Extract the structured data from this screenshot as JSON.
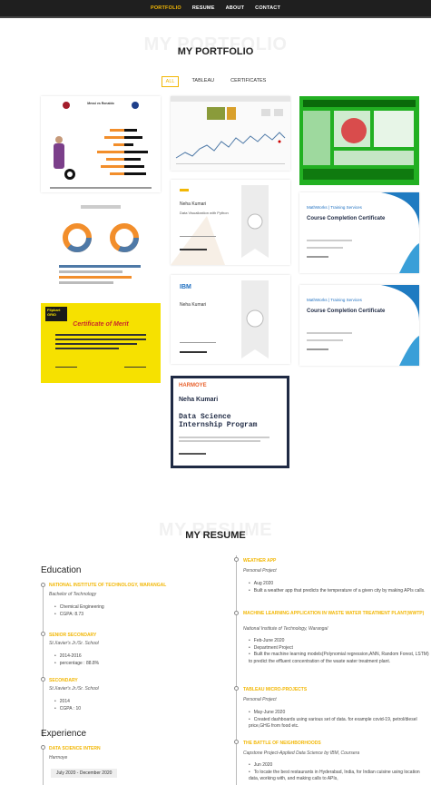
{
  "nav": {
    "items": [
      "PORTFOLIO",
      "RESUME",
      "ABOUT",
      "CONTACT"
    ]
  },
  "portfolio": {
    "ghost_title": "MY PORTFOLIO",
    "title": "MY PORTFOLIO",
    "filters": [
      "ALL",
      "TABLEAU",
      "CERTIFICATES"
    ],
    "thumb_texts": {
      "messi_title": "Messi vs Ronaldo",
      "ibm_name": "Neha Kumari",
      "ibm_course": "Data Visualization with Python",
      "mathworks_brand": "MathWorks | Training Services",
      "mathworks_cert": "Course Completion Certificate",
      "flipkart_brand": "Flipkart GRiD",
      "merit_title": "Certificate of Merit",
      "ibm_logo": "IBM",
      "ibm2_name": "Neha Kumari",
      "harmoye_logo": "HARMOYE",
      "harmoye_name": "Neha Kumari",
      "harmoye_program": "Data Science Internship Program"
    }
  },
  "resume": {
    "ghost_title": "MY RESUME",
    "title": "MY RESUME",
    "education_heading": "Education",
    "experience_heading": "Experience",
    "education": [
      {
        "title": "NATIONAL INSTITUTE OF TECHNOLOGY, WARANGAL",
        "sub": "Bachelor of Technology",
        "items": [
          "Chemical Engineering",
          "CGPA: 8.73"
        ]
      },
      {
        "title": "SENIOR SECONDARY",
        "sub": "St.Xavier's Jr./Sr. School",
        "items": [
          "2014-2016",
          "percentage : 88.8%"
        ]
      },
      {
        "title": "SECONDARY",
        "sub": "St.Xavier's Jr./Sr. School",
        "items": [
          "2014",
          "CGPA : 10"
        ]
      }
    ],
    "experience": [
      {
        "title": "DATA SCIENCE INTERN",
        "sub": "Harmoye",
        "date": "July 2020 - December 2020"
      }
    ],
    "projects": [
      {
        "title": "WEATHER APP",
        "sub": "Personal Project",
        "items": [
          "Aug 2020",
          "Built a weather app that predicts the temperature of a given city by making APIs calls."
        ]
      },
      {
        "title": "MACHINE LEARNING APPLICATION IN WASTE WATER TREATMENT PLANT(WWTP)",
        "sub": "National Institute of Technology, Warangal",
        "items": [
          "Feb-June 2020",
          "Department Project",
          "Built the machine learning models(Polynomial regression,ANN, Random Forest, LSTM) to predict the effluent concentration of the waste water treatment plant."
        ]
      },
      {
        "title": "TABLEAU MICRO-PROJECTS",
        "sub": "Personal Project",
        "items": [
          "May-June 2020",
          "Created dashboards using various set of data. for example covid-19, petrol/diesel price,GHG from food etc."
        ]
      },
      {
        "title": "THE BATTLE OF NEIGHBORHOODS",
        "sub": "Capstone Project-Applied Data Science by IBM, Coursera",
        "items": [
          "Jun 2020",
          "To locate the best restaurants in Hyderabad, India, for Indian cuisine using location data, working with, and making calls to APIs,"
        ]
      }
    ]
  }
}
